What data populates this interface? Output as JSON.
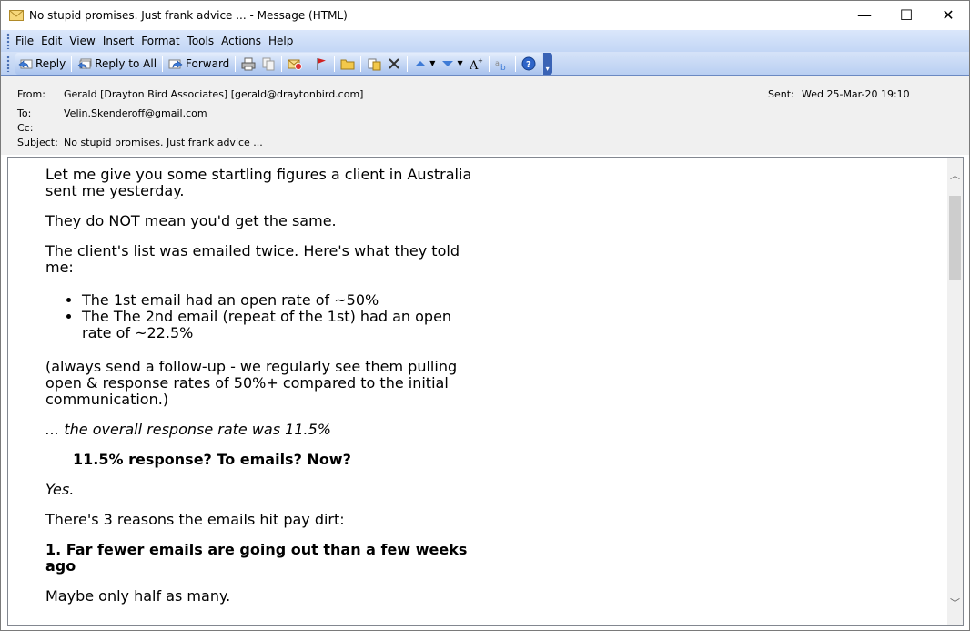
{
  "window": {
    "title": "No stupid promises. Just frank advice ... - Message (HTML)",
    "controls": {
      "minimize": "—",
      "maximize": "☐",
      "close": "✕"
    }
  },
  "menubar": {
    "items": [
      "File",
      "Edit",
      "View",
      "Insert",
      "Format",
      "Tools",
      "Actions",
      "Help"
    ]
  },
  "toolbar": {
    "reply": "Reply",
    "reply_all": "Reply to All",
    "forward": "Forward"
  },
  "header": {
    "from_label": "From:",
    "from_value": "Gerald [Drayton Bird Associates] [gerald@draytonbird.com]",
    "sent_label": "Sent:",
    "sent_value": "Wed 25-Mar-20 19:10",
    "to_label": "To:",
    "to_value": "Velin.Skenderoff@gmail.com",
    "cc_label": "Cc:",
    "cc_value": "",
    "subject_label": "Subject:",
    "subject_value": "No stupid promises. Just frank advice ..."
  },
  "message": {
    "p1": "Let me give you some startling figures a client in Australia sent me yesterday.",
    "p2": "They do NOT mean you'd get the same.",
    "p3": "The client's list was emailed twice.  Here's what they told me:",
    "bullets": [
      "The 1st email had an open rate of ~50%",
      "The The 2nd email (repeat of the 1st) had an open rate of ~22.5%"
    ],
    "p4": "(always send a follow-up - we regularly see them pulling open & response rates of 50%+ compared to the initial communication.)",
    "p5": "... the overall response rate was 11.5%",
    "p6": "11.5% response? To emails? Now?",
    "p7": "Yes.",
    "p8": "There's 3 reasons the emails hit pay dirt:",
    "p9": "1. Far fewer emails are going out than a few weeks ago",
    "p10": "Maybe only half as many."
  },
  "colors": {
    "menubar": "#c3d6f5",
    "toolbar_border": "#6b89c2",
    "header_bg": "#f0f0f0"
  }
}
